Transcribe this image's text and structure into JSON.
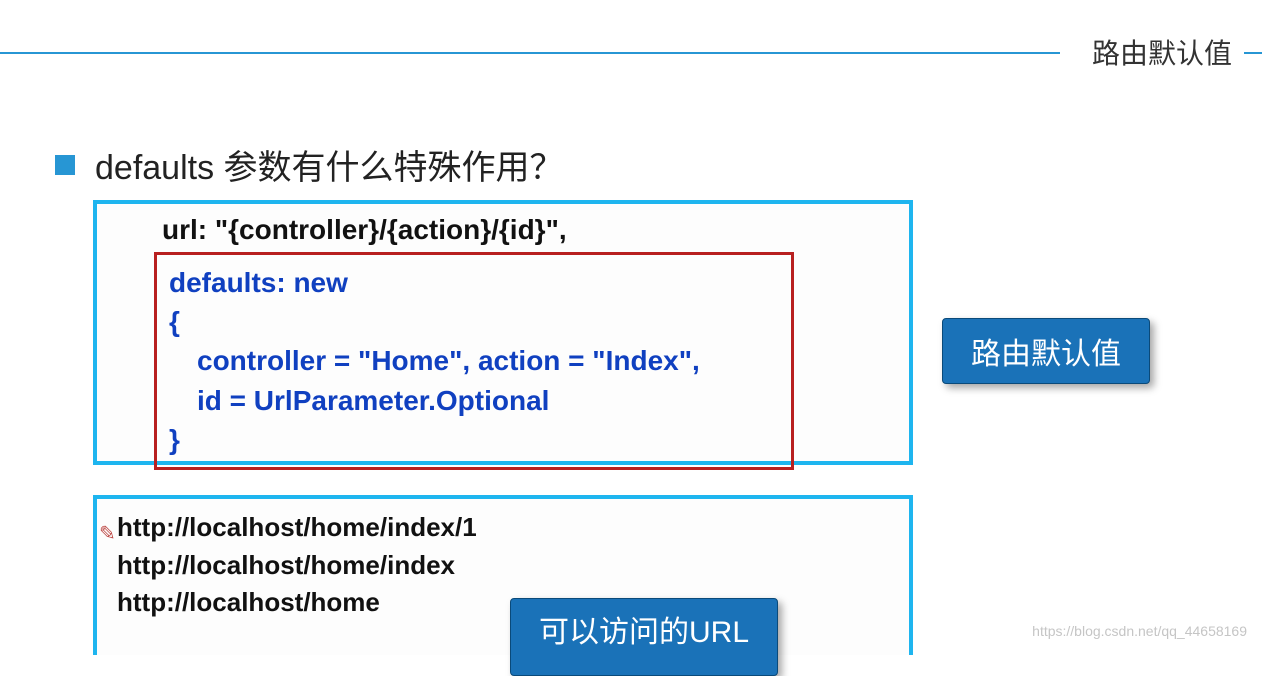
{
  "header": {
    "top_label": "路由默认值"
  },
  "bullet": {
    "question": "defaults 参数有什么特殊作用？"
  },
  "code_box_1": {
    "url_line": "url: \"{controller}/{action}/{id}\",",
    "line1": "defaults: new",
    "line2": "{",
    "line3": "controller = \"Home\",   action = \"Index\",",
    "line4": "id = UrlParameter.Optional",
    "line5": "}"
  },
  "badge_1": "路由默认值",
  "code_box_2": {
    "url1": "http://localhost/home/index/1",
    "url2": "http://localhost/home/index",
    "url3": "http://localhost/home"
  },
  "badge_2": "可以访问的URL",
  "watermark": "https://blog.csdn.net/qq_44658169"
}
